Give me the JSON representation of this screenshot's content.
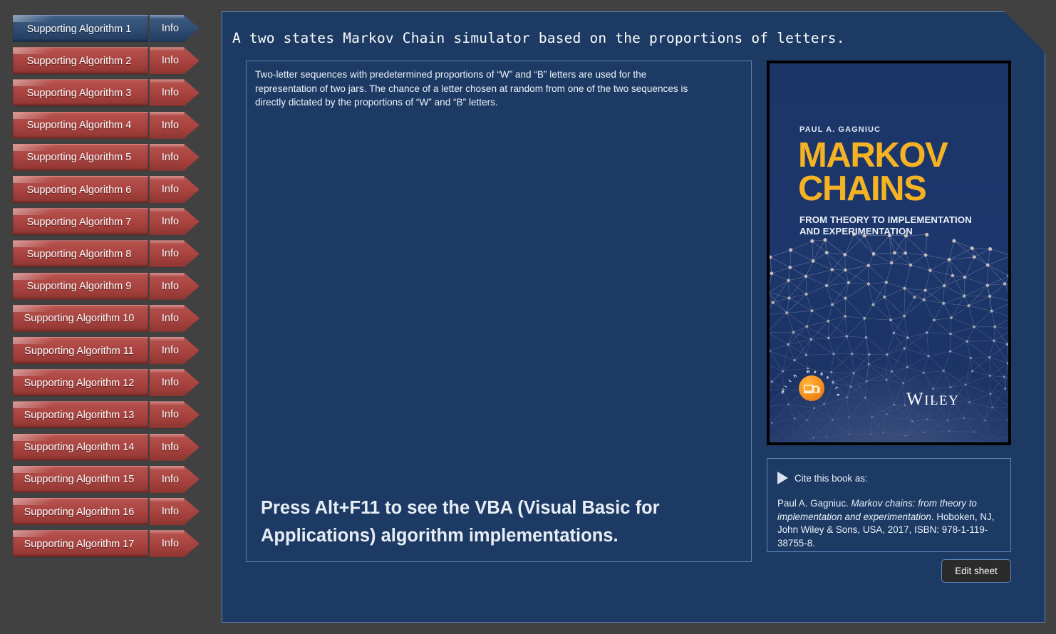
{
  "colors": {
    "outer_background": "#414141",
    "panel_background": "#1c3a63",
    "panel_border": "#5c86bd",
    "selected_item": "#2f4c72",
    "default_item": "#a8423f",
    "book_title_accent": "#f5b324",
    "badge_orange": "#f6921e"
  },
  "sidebar": {
    "info_label": "Info",
    "items": [
      {
        "label": "Supporting Algorithm 1",
        "selected": true
      },
      {
        "label": "Supporting Algorithm 2",
        "selected": false
      },
      {
        "label": "Supporting Algorithm 3",
        "selected": false
      },
      {
        "label": "Supporting Algorithm 4",
        "selected": false
      },
      {
        "label": "Supporting Algorithm 5",
        "selected": false
      },
      {
        "label": "Supporting Algorithm 6",
        "selected": false
      },
      {
        "label": "Supporting Algorithm 7",
        "selected": false
      },
      {
        "label": "Supporting Algorithm 8",
        "selected": false
      },
      {
        "label": "Supporting Algorithm 9",
        "selected": false
      },
      {
        "label": "Supporting Algorithm 10",
        "selected": false
      },
      {
        "label": "Supporting Algorithm 11",
        "selected": false
      },
      {
        "label": "Supporting Algorithm 12",
        "selected": false
      },
      {
        "label": "Supporting Algorithm 13",
        "selected": false
      },
      {
        "label": "Supporting Algorithm 14",
        "selected": false
      },
      {
        "label": "Supporting Algorithm 15",
        "selected": false
      },
      {
        "label": "Supporting Algorithm 16",
        "selected": false
      },
      {
        "label": "Supporting Algorithm 17",
        "selected": false
      }
    ]
  },
  "main": {
    "title": "A two states Markov Chain simulator based on the proportions of letters.",
    "description": "Two-letter sequences with predetermined proportions of “W” and “B” letters are used for the representation of two jars. The chance of a letter chosen at random from one of the two sequences is directly dictated by the proportions of “W” and “B” letters.",
    "vba_note": "Press Alt+F11 to see the VBA (Visual Basic for Applications) algorithm implementations."
  },
  "book": {
    "author": "PAUL A. GAGNIUC",
    "title_line_1": "MARKOV",
    "title_line_2": "CHAINS",
    "subtitle": "FROM THEORY TO IMPLEMENTATION AND EXPERIMENTATION",
    "badge_text": "with website",
    "publisher": "WILEY"
  },
  "citation": {
    "heading": "Cite this book as:",
    "author_prefix": "Paul A. Gagniuc. ",
    "title_italic": "Markov chains: from theory to implementation and experimentation",
    "suffix": ". Hoboken, NJ, John Wiley & Sons, USA, 2017, ISBN: 978-1-119-38755-8."
  },
  "actions": {
    "edit_sheet_label": "Edit sheet"
  }
}
